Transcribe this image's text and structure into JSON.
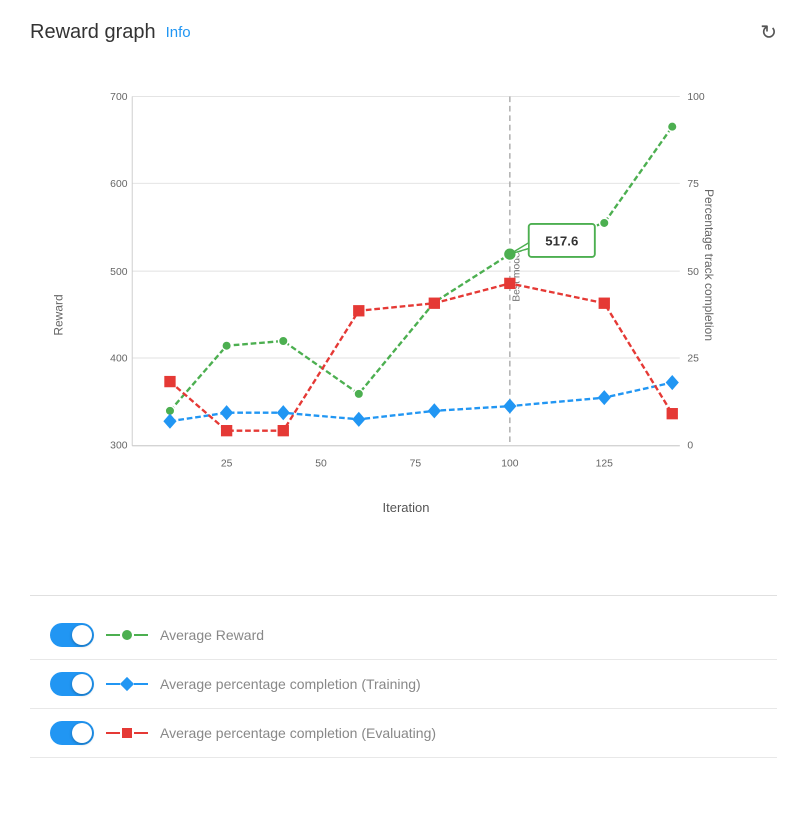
{
  "header": {
    "title": "Reward graph",
    "info_label": "Info",
    "refresh_icon": "↻"
  },
  "chart": {
    "y_axis_label": "Reward",
    "y_axis_right_label": "Percentage track completion",
    "x_axis_label": "Iteration",
    "y_ticks": [
      300,
      400,
      500,
      600,
      700
    ],
    "y_right_ticks": [
      0,
      25,
      50,
      75,
      100
    ],
    "x_ticks": [
      25,
      50,
      75,
      100,
      125
    ],
    "best_model_label": "Best model",
    "tooltip_value": "517.6",
    "colors": {
      "green": "#4CAF50",
      "blue": "#2196F3",
      "red": "#e53935"
    }
  },
  "legend": {
    "items": [
      {
        "label": "Average Reward",
        "color": "#4CAF50",
        "enabled": true
      },
      {
        "label": "Average percentage completion (Training)",
        "color": "#2196F3",
        "enabled": true
      },
      {
        "label": "Average percentage completion (Evaluating)",
        "color": "#e53935",
        "enabled": true
      }
    ]
  }
}
